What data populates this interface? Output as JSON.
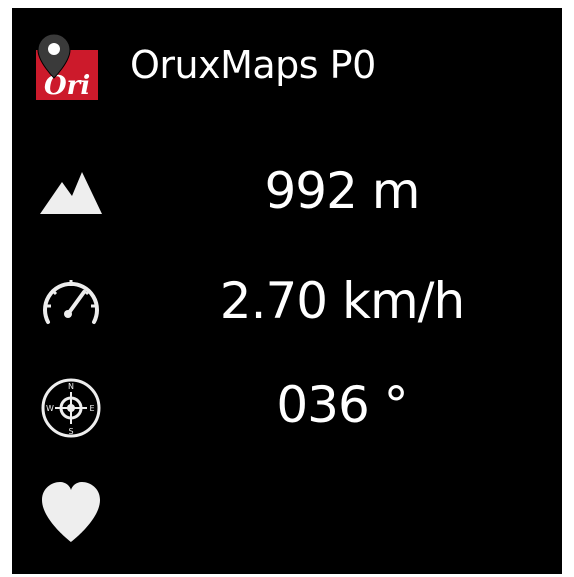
{
  "app": {
    "title": "OruxMaps P0",
    "logo_text": "Ori",
    "brand_color": "#cc1a2b"
  },
  "stats": {
    "altitude": {
      "icon": "mountain-icon",
      "value": "992 m"
    },
    "speed": {
      "icon": "speedometer-icon",
      "value": "2.70 km/h"
    },
    "heading": {
      "icon": "compass-icon",
      "value": "036 °"
    },
    "heart_rate": {
      "icon": "heart-icon",
      "value": ""
    }
  },
  "compass_letters": {
    "n": "N",
    "s": "S",
    "w": "W",
    "e": "E"
  },
  "colors": {
    "background": "#000000",
    "text": "#ffffff",
    "icon": "#eeeeee"
  }
}
